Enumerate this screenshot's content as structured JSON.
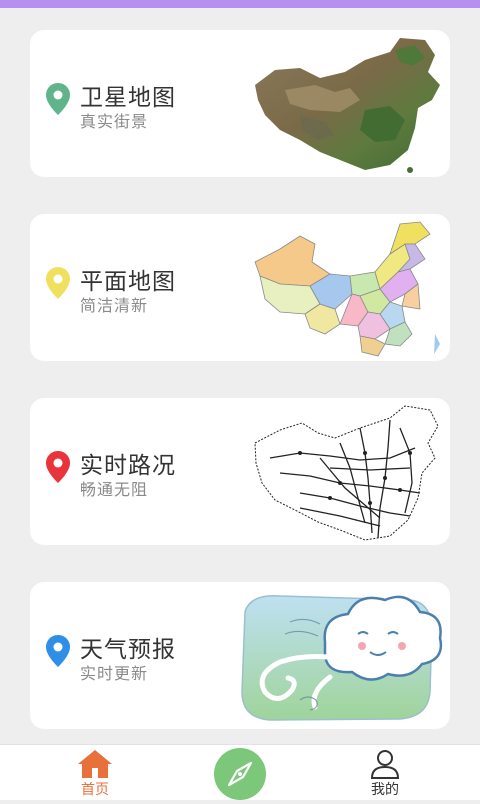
{
  "cards": [
    {
      "title": "卫星地图",
      "subtitle": "真实街景",
      "pin_color": "#5fb489",
      "art": "satellite-china-map"
    },
    {
      "title": "平面地图",
      "subtitle": "简洁清新",
      "pin_color": "#f0e060",
      "art": "political-china-map"
    },
    {
      "title": "实时路况",
      "subtitle": "畅通无阻",
      "pin_color": "#e8343a",
      "art": "railway-china-map"
    },
    {
      "title": "天气预报",
      "subtitle": "实时更新",
      "pin_color": "#2f8fe8",
      "art": "cartoon-cloud-wind"
    }
  ],
  "tabbar": {
    "home_label": "首页",
    "mine_label": "我的",
    "home_color": "#e8703a",
    "compass_color": "#7cc77a"
  }
}
